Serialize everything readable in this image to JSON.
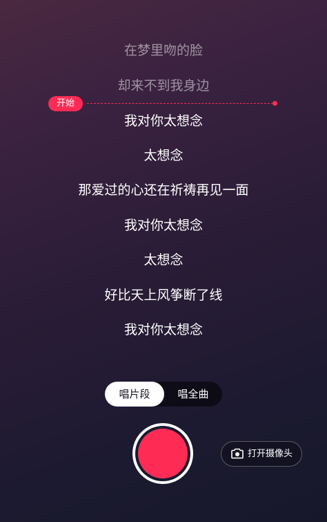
{
  "lyrics": [
    {
      "text": "在梦里吻的脸",
      "state": "past"
    },
    {
      "text": "却来不到我身边",
      "state": "past"
    },
    {
      "text": "我对你太想念",
      "state": "upcoming"
    },
    {
      "text": "太想念",
      "state": "upcoming"
    },
    {
      "text": "那爱过的心还在祈祷再见一面",
      "state": "upcoming"
    },
    {
      "text": "我对你太想念",
      "state": "upcoming"
    },
    {
      "text": "太想念",
      "state": "upcoming"
    },
    {
      "text": "好比天上风筝断了线",
      "state": "upcoming"
    },
    {
      "text": "我对你太想念",
      "state": "upcoming"
    }
  ],
  "start_marker": {
    "label": "开始"
  },
  "mode_toggle": {
    "options": [
      "唱片段",
      "唱全曲"
    ],
    "selected": "唱片段"
  },
  "record_button": {
    "icon": "record-circle"
  },
  "camera_button": {
    "label": "打开摄像头",
    "icon": "camera-icon"
  },
  "colors": {
    "accent": "#fe2c55",
    "text": "#ffffff",
    "text_dim": "rgba(255,255,255,0.5)"
  }
}
